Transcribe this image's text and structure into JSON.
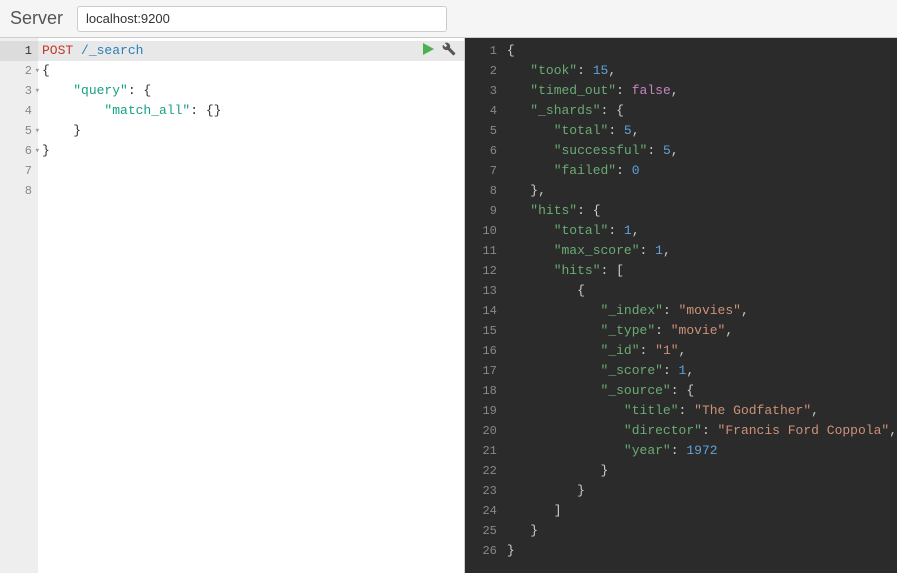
{
  "header": {
    "server_label": "Server",
    "server_value": "localhost:9200"
  },
  "request": {
    "lines": [
      {
        "n": "1",
        "active": true,
        "tokens": [
          [
            "kw-post",
            "POST"
          ],
          [
            "",
            ""
          ],
          [
            "kw-path",
            " /_search"
          ]
        ]
      },
      {
        "n": "2",
        "fold": true,
        "tokens": [
          [
            "kw-punc",
            "{"
          ]
        ]
      },
      {
        "n": "3",
        "fold": true,
        "tokens": [
          [
            "",
            "    "
          ],
          [
            "kw-key",
            "\"query\""
          ],
          [
            "kw-punc",
            ": {"
          ]
        ]
      },
      {
        "n": "4",
        "tokens": [
          [
            "",
            "        "
          ],
          [
            "kw-key",
            "\"match_all\""
          ],
          [
            "kw-punc",
            ": {}"
          ]
        ]
      },
      {
        "n": "5",
        "fold": true,
        "tokens": [
          [
            "",
            "    "
          ],
          [
            "kw-punc",
            "}"
          ]
        ]
      },
      {
        "n": "6",
        "fold": true,
        "tokens": [
          [
            "kw-punc",
            "}"
          ]
        ]
      },
      {
        "n": "7",
        "tokens": []
      },
      {
        "n": "8",
        "tokens": []
      }
    ]
  },
  "response": {
    "lines": [
      {
        "n": "1",
        "tokens": [
          [
            "d-punc",
            "{"
          ]
        ]
      },
      {
        "n": "2",
        "tokens": [
          [
            "",
            "   "
          ],
          [
            "d-key",
            "\"took\""
          ],
          [
            "d-punc",
            ": "
          ],
          [
            "d-num",
            "15"
          ],
          [
            "d-punc",
            ","
          ]
        ]
      },
      {
        "n": "3",
        "tokens": [
          [
            "",
            "   "
          ],
          [
            "d-key",
            "\"timed_out\""
          ],
          [
            "d-punc",
            ": "
          ],
          [
            "d-bool",
            "false"
          ],
          [
            "d-punc",
            ","
          ]
        ]
      },
      {
        "n": "4",
        "tokens": [
          [
            "",
            "   "
          ],
          [
            "d-key",
            "\"_shards\""
          ],
          [
            "d-punc",
            ": {"
          ]
        ]
      },
      {
        "n": "5",
        "tokens": [
          [
            "",
            "      "
          ],
          [
            "d-key",
            "\"total\""
          ],
          [
            "d-punc",
            ": "
          ],
          [
            "d-num",
            "5"
          ],
          [
            "d-punc",
            ","
          ]
        ]
      },
      {
        "n": "6",
        "tokens": [
          [
            "",
            "      "
          ],
          [
            "d-key",
            "\"successful\""
          ],
          [
            "d-punc",
            ": "
          ],
          [
            "d-num",
            "5"
          ],
          [
            "d-punc",
            ","
          ]
        ]
      },
      {
        "n": "7",
        "tokens": [
          [
            "",
            "      "
          ],
          [
            "d-key",
            "\"failed\""
          ],
          [
            "d-punc",
            ": "
          ],
          [
            "d-num",
            "0"
          ]
        ]
      },
      {
        "n": "8",
        "tokens": [
          [
            "",
            "   "
          ],
          [
            "d-punc",
            "},"
          ]
        ]
      },
      {
        "n": "9",
        "tokens": [
          [
            "",
            "   "
          ],
          [
            "d-key",
            "\"hits\""
          ],
          [
            "d-punc",
            ": {"
          ]
        ]
      },
      {
        "n": "10",
        "tokens": [
          [
            "",
            "      "
          ],
          [
            "d-key",
            "\"total\""
          ],
          [
            "d-punc",
            ": "
          ],
          [
            "d-num",
            "1"
          ],
          [
            "d-punc",
            ","
          ]
        ]
      },
      {
        "n": "11",
        "tokens": [
          [
            "",
            "      "
          ],
          [
            "d-key",
            "\"max_score\""
          ],
          [
            "d-punc",
            ": "
          ],
          [
            "d-num",
            "1"
          ],
          [
            "d-punc",
            ","
          ]
        ]
      },
      {
        "n": "12",
        "tokens": [
          [
            "",
            "      "
          ],
          [
            "d-key",
            "\"hits\""
          ],
          [
            "d-punc",
            ": ["
          ]
        ]
      },
      {
        "n": "13",
        "tokens": [
          [
            "",
            "         "
          ],
          [
            "d-punc",
            "{"
          ]
        ]
      },
      {
        "n": "14",
        "tokens": [
          [
            "",
            "            "
          ],
          [
            "d-key",
            "\"_index\""
          ],
          [
            "d-punc",
            ": "
          ],
          [
            "d-str",
            "\"movies\""
          ],
          [
            "d-punc",
            ","
          ]
        ]
      },
      {
        "n": "15",
        "tokens": [
          [
            "",
            "            "
          ],
          [
            "d-key",
            "\"_type\""
          ],
          [
            "d-punc",
            ": "
          ],
          [
            "d-str",
            "\"movie\""
          ],
          [
            "d-punc",
            ","
          ]
        ]
      },
      {
        "n": "16",
        "tokens": [
          [
            "",
            "            "
          ],
          [
            "d-key",
            "\"_id\""
          ],
          [
            "d-punc",
            ": "
          ],
          [
            "d-str",
            "\"1\""
          ],
          [
            "d-punc",
            ","
          ]
        ]
      },
      {
        "n": "17",
        "tokens": [
          [
            "",
            "            "
          ],
          [
            "d-key",
            "\"_score\""
          ],
          [
            "d-punc",
            ": "
          ],
          [
            "d-num",
            "1"
          ],
          [
            "d-punc",
            ","
          ]
        ]
      },
      {
        "n": "18",
        "tokens": [
          [
            "",
            "            "
          ],
          [
            "d-key",
            "\"_source\""
          ],
          [
            "d-punc",
            ": {"
          ]
        ]
      },
      {
        "n": "19",
        "tokens": [
          [
            "",
            "               "
          ],
          [
            "d-key",
            "\"title\""
          ],
          [
            "d-punc",
            ": "
          ],
          [
            "d-str",
            "\"The Godfather\""
          ],
          [
            "d-punc",
            ","
          ]
        ]
      },
      {
        "n": "20",
        "tokens": [
          [
            "",
            "               "
          ],
          [
            "d-key",
            "\"director\""
          ],
          [
            "d-punc",
            ": "
          ],
          [
            "d-str",
            "\"Francis Ford Coppola\""
          ],
          [
            "d-punc",
            ","
          ]
        ]
      },
      {
        "n": "21",
        "tokens": [
          [
            "",
            "               "
          ],
          [
            "d-key",
            "\"year\""
          ],
          [
            "d-punc",
            ": "
          ],
          [
            "d-num",
            "1972"
          ]
        ]
      },
      {
        "n": "22",
        "tokens": [
          [
            "",
            "            "
          ],
          [
            "d-punc",
            "}"
          ]
        ]
      },
      {
        "n": "23",
        "tokens": [
          [
            "",
            "         "
          ],
          [
            "d-punc",
            "}"
          ]
        ]
      },
      {
        "n": "24",
        "tokens": [
          [
            "",
            "      "
          ],
          [
            "d-punc",
            "]"
          ]
        ]
      },
      {
        "n": "25",
        "tokens": [
          [
            "",
            "   "
          ],
          [
            "d-punc",
            "}"
          ]
        ]
      },
      {
        "n": "26",
        "tokens": [
          [
            "d-punc",
            "}"
          ]
        ]
      }
    ]
  }
}
